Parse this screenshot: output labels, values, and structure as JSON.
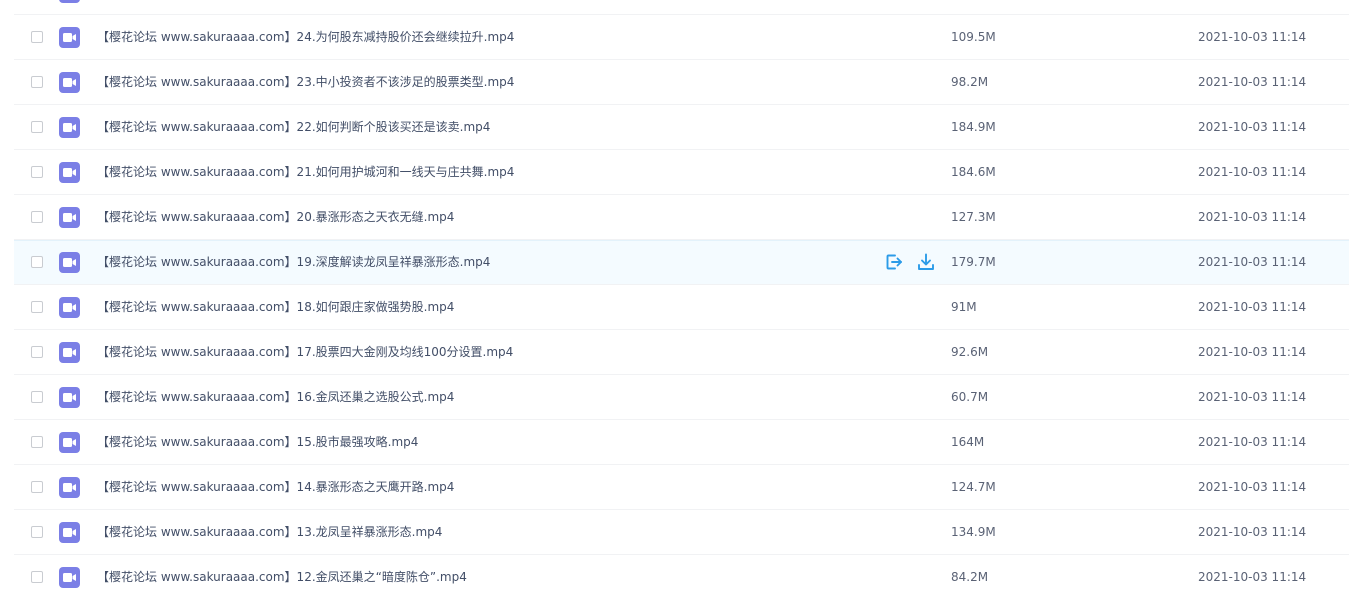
{
  "colors": {
    "video_icon": "#7b7fe6",
    "action_icon": "#2b9be8",
    "hover_row": "#f4fbff"
  },
  "row_actions": {
    "share_icon": "share-export-icon",
    "download_icon": "download-icon"
  },
  "files": [
    {
      "name": "",
      "size": "",
      "date": ""
    },
    {
      "name": "【樱花论坛 www.sakuraaaa.com】24.为何股东减持股价还会继续拉升.mp4",
      "size": "109.5M",
      "date": "2021-10-03 11:14"
    },
    {
      "name": "【樱花论坛 www.sakuraaaa.com】23.中小投资者不该涉足的股票类型.mp4",
      "size": "98.2M",
      "date": "2021-10-03 11:14"
    },
    {
      "name": "【樱花论坛 www.sakuraaaa.com】22.如何判断个股该买还是该卖.mp4",
      "size": "184.9M",
      "date": "2021-10-03 11:14"
    },
    {
      "name": "【樱花论坛 www.sakuraaaa.com】21.如何用护城河和一线天与庄共舞.mp4",
      "size": "184.6M",
      "date": "2021-10-03 11:14"
    },
    {
      "name": "【樱花论坛 www.sakuraaaa.com】20.暴涨形态之天衣无缝.mp4",
      "size": "127.3M",
      "date": "2021-10-03 11:14"
    },
    {
      "name": "【樱花论坛 www.sakuraaaa.com】19.深度解读龙凤呈祥暴涨形态.mp4",
      "size": "179.7M",
      "date": "2021-10-03 11:14",
      "hover": true
    },
    {
      "name": "【樱花论坛 www.sakuraaaa.com】18.如何跟庄家做强势股.mp4",
      "size": "91M",
      "date": "2021-10-03 11:14"
    },
    {
      "name": "【樱花论坛 www.sakuraaaa.com】17.股票四大金刚及均线100分设置.mp4",
      "size": "92.6M",
      "date": "2021-10-03 11:14"
    },
    {
      "name": "【樱花论坛 www.sakuraaaa.com】16.金凤还巢之选股公式.mp4",
      "size": "60.7M",
      "date": "2021-10-03 11:14"
    },
    {
      "name": "【樱花论坛 www.sakuraaaa.com】15.股市最强攻略.mp4",
      "size": "164M",
      "date": "2021-10-03 11:14"
    },
    {
      "name": "【樱花论坛 www.sakuraaaa.com】14.暴涨形态之天鹰开路.mp4",
      "size": "124.7M",
      "date": "2021-10-03 11:14"
    },
    {
      "name": "【樱花论坛 www.sakuraaaa.com】13.龙凤呈祥暴涨形态.mp4",
      "size": "134.9M",
      "date": "2021-10-03 11:14"
    },
    {
      "name": "【樱花论坛 www.sakuraaaa.com】12.金凤还巢之“暗度陈仓”.mp4",
      "size": "84.2M",
      "date": "2021-10-03 11:14"
    }
  ]
}
